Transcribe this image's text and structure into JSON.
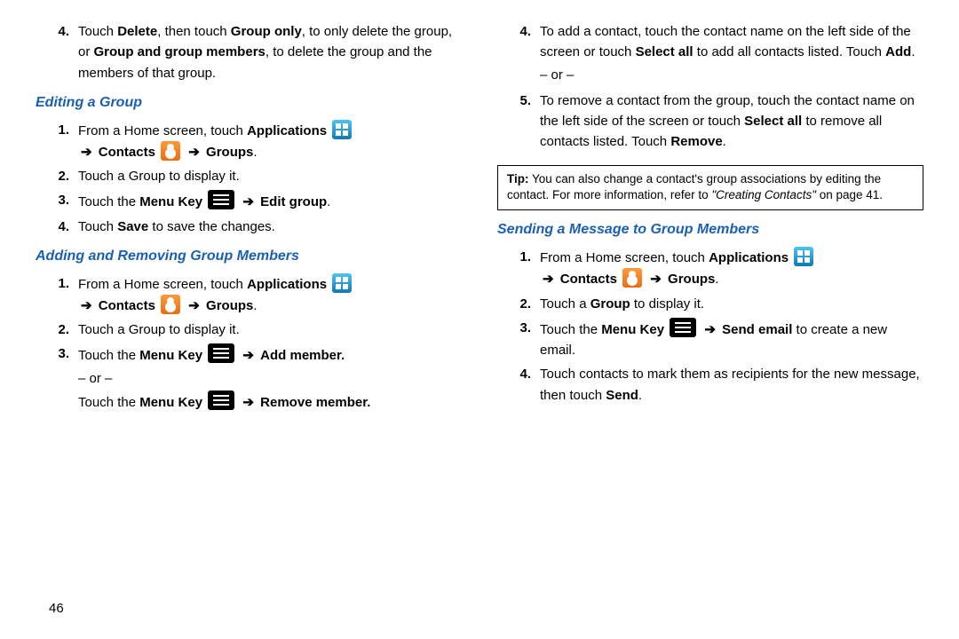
{
  "page_number": "46",
  "left": {
    "intro_item": {
      "num": "4.",
      "text_pre": "Touch ",
      "delete": "Delete",
      "text_mid1": ", then touch ",
      "group_only": "Group only",
      "text_mid2": ", to only delete the group, or ",
      "group_members": "Group and group members",
      "text_end": ", to delete the group and the members of that group."
    },
    "heading_edit": "Editing a Group",
    "edit_steps": [
      {
        "num": "1.",
        "pre": "From a Home screen, touch ",
        "apps": "Applications",
        "contacts": "Contacts",
        "groups": "Groups"
      },
      {
        "num": "2.",
        "text": "Touch a Group to display it."
      },
      {
        "num": "3.",
        "pre": "Touch the ",
        "menukey": "Menu Key",
        "action": "Edit group",
        "post": "."
      },
      {
        "num": "4.",
        "pre": "Touch ",
        "save": "Save",
        "post": " to save the changes."
      }
    ],
    "heading_addremove": "Adding and Removing Group Members",
    "ar_steps": [
      {
        "num": "1.",
        "pre": "From a Home screen, touch ",
        "apps": "Applications",
        "contacts": "Contacts",
        "groups": "Groups"
      },
      {
        "num": "2.",
        "text": "Touch a Group to display it."
      },
      {
        "num": "3.",
        "line1_pre": "Touch the ",
        "menukey": "Menu Key",
        "add": "Add member.",
        "or": "– or –",
        "line2_pre": "Touch the ",
        "remove": "Remove member."
      }
    ]
  },
  "right": {
    "top_items": [
      {
        "num": "4.",
        "text_pre": "To add a contact, touch the contact name on the left side of the screen or touch ",
        "selectall": "Select all",
        "text_mid": " to add all contacts listed. Touch ",
        "add": "Add",
        "text_post": ".",
        "or": "– or –"
      },
      {
        "num": "5.",
        "text_pre": "To remove a contact from the group, touch the contact name on the left side of the screen or touch ",
        "selectall": "Select all",
        "text_mid": " to remove all contacts listed. Touch ",
        "remove": "Remove",
        "text_post": "."
      }
    ],
    "tip": {
      "label": "Tip:",
      "text": " You can also change a contact's group associations by editing the contact. For more information, refer to ",
      "ref": "\"Creating Contacts\"",
      "page": " on page 41."
    },
    "heading_send": "Sending a Message to Group Members",
    "send_steps": [
      {
        "num": "1.",
        "pre": "From a Home screen, touch ",
        "apps": "Applications",
        "contacts": "Contacts",
        "groups": "Groups"
      },
      {
        "num": "2.",
        "pre": "Touch a ",
        "group": "Group",
        "post": " to display it."
      },
      {
        "num": "3.",
        "pre": "Touch the ",
        "menukey": "Menu Key",
        "action": "Send email",
        "post": " to create a new email."
      },
      {
        "num": "4.",
        "pre": "Touch contacts to mark them as recipients for the new message, then touch ",
        "send": "Send",
        "post": "."
      }
    ]
  }
}
